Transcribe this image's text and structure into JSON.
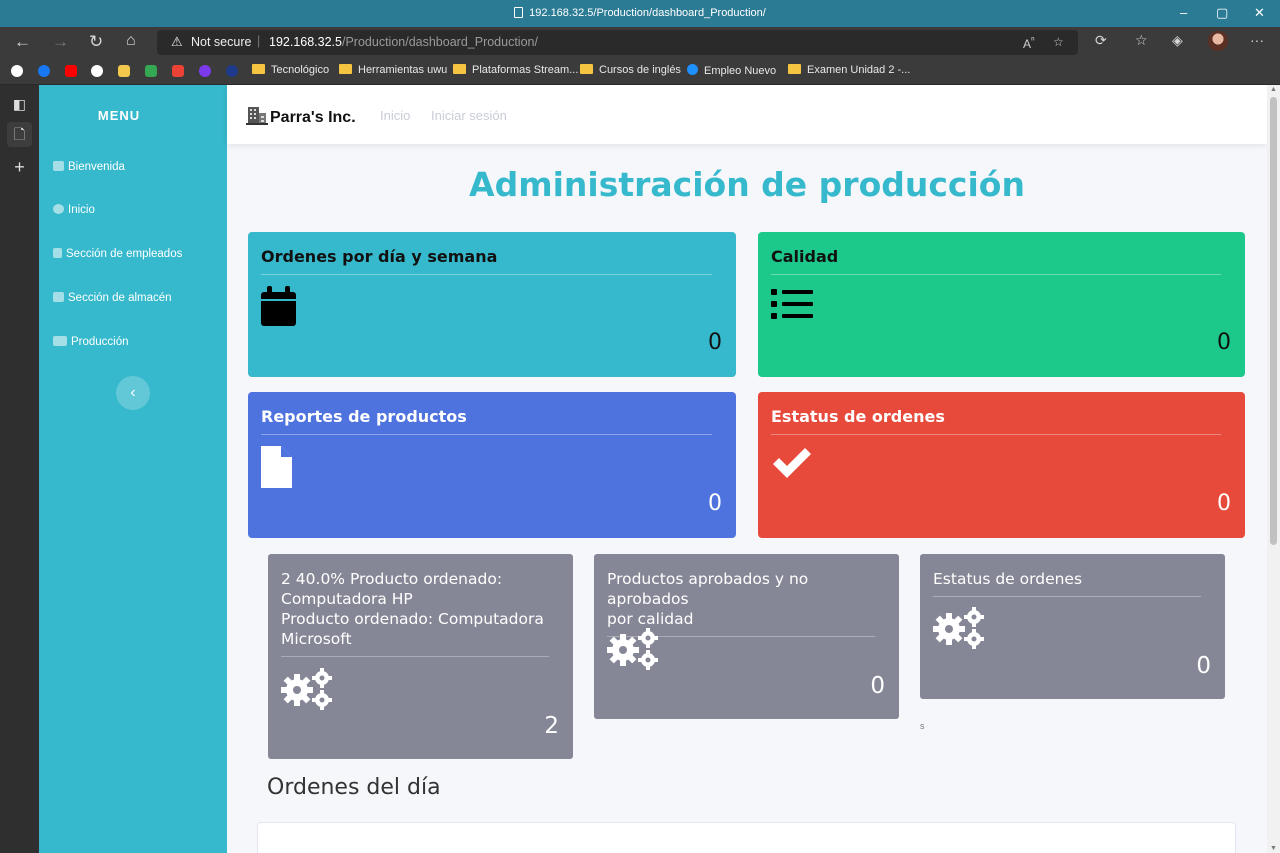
{
  "browser": {
    "tab_title": "192.168.32.5/Production/dashboard_Production/",
    "security_label": "Not secure",
    "url_host": "192.168.32.5",
    "url_path": "/Production/dashboard_Production/",
    "bookmarks": [
      "Tecnológico",
      "Herramientas uwu",
      "Plataformas Stream...",
      "Cursos de inglés",
      "Empleo Nuevo",
      "Examen Unidad 2 -..."
    ]
  },
  "sidebar": {
    "title": "MENU",
    "items": [
      {
        "label": "Bienvenida",
        "icon": "home-icon"
      },
      {
        "label": "Inicio",
        "icon": "dashboard-icon"
      },
      {
        "label": "Sección de empleados",
        "icon": "user-icon"
      },
      {
        "label": "Sección de almacén",
        "icon": "warehouse-icon"
      },
      {
        "label": "Producción",
        "icon": "gears-icon"
      }
    ],
    "collapse_symbol": "‹"
  },
  "topbar": {
    "brand": "Parra's Inc.",
    "nav": [
      "Inicio",
      "Iniciar sesión"
    ]
  },
  "main": {
    "heading": "Administración de producción",
    "cards": [
      {
        "title": "Ordenes por día y semana",
        "value": "0",
        "color": "#36b9cc",
        "icon": "calendar-icon"
      },
      {
        "title": "Calidad",
        "value": "0",
        "color": "#1cc88a",
        "icon": "list-icon"
      },
      {
        "title": "Reportes de productos",
        "value": "0",
        "color": "#4e73df",
        "icon": "file-icon"
      },
      {
        "title": "Estatus de ordenes",
        "value": "0",
        "color": "#e74a3b",
        "icon": "check-icon"
      }
    ],
    "gray_cards": [
      {
        "title_lines": [
          "2 40.0% Producto ordenado:",
          "Computadora HP",
          "Producto ordenado: Computadora",
          "Microsoft"
        ],
        "value": "2"
      },
      {
        "title_lines": [
          "Productos aprobados y no aprobados",
          "por calidad"
        ],
        "value": "0"
      },
      {
        "title_lines": [
          "Estatus de ordenes"
        ],
        "value": "0"
      }
    ],
    "stray_text": "s",
    "subheading": "Ordenes del día"
  }
}
